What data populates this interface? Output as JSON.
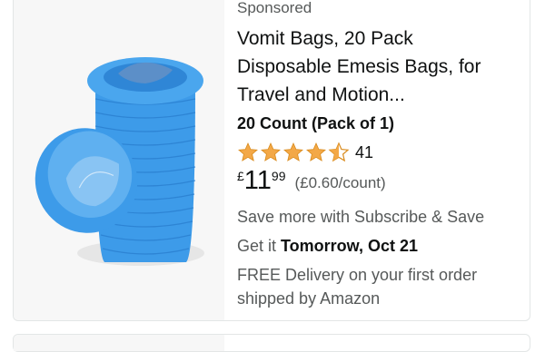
{
  "product": {
    "sponsored": "Sponsored",
    "title_line1": "Vomit Bags, 20 Pack",
    "title_line2": "Disposable Emesis Bags, for",
    "title_line3": "Travel and Motion...",
    "variant": "20 Count (Pack of 1)",
    "rating": 4.5,
    "rating_count": "41",
    "price_currency": "£",
    "price_whole": "11",
    "price_fraction": "99",
    "unit_price": "(£0.60/count)",
    "subscribe_text": "Save more with Subscribe & Save",
    "delivery_prefix": "Get it ",
    "delivery_date": "Tomorrow, Oct 21",
    "free_delivery_line1": "FREE Delivery on your first order",
    "free_delivery_line2": "shipped by Amazon",
    "image_icon": "blue-emesis-bags-stack-image"
  },
  "colors": {
    "star": "#f3a847",
    "bag_blue": "#3d9be9",
    "bag_dark": "#2a7fd0"
  }
}
